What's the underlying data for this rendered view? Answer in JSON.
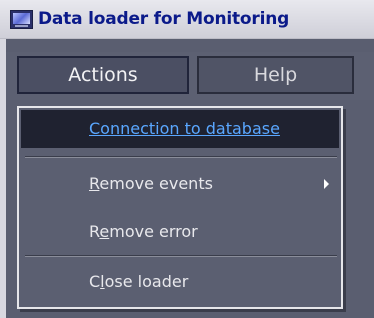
{
  "window": {
    "title": "Data loader for Monitoring",
    "icon": "monitor-app-icon"
  },
  "menubar": {
    "actions_label": "Actions",
    "help_label": "Help"
  },
  "dropdown": {
    "items": [
      {
        "label": "Connection to database",
        "mnemonic_index": 0,
        "selected": true
      },
      {
        "label": "Remove events",
        "mnemonic_index": 0,
        "has_submenu": true
      },
      {
        "label": "Remove error",
        "mnemonic_index": 1
      },
      {
        "label": "Close loader",
        "mnemonic_index": 1
      }
    ]
  },
  "colors": {
    "title_text": "#0b1a8a",
    "selected_text": "#5aa7ff",
    "menu_background": "#5b5f71"
  }
}
